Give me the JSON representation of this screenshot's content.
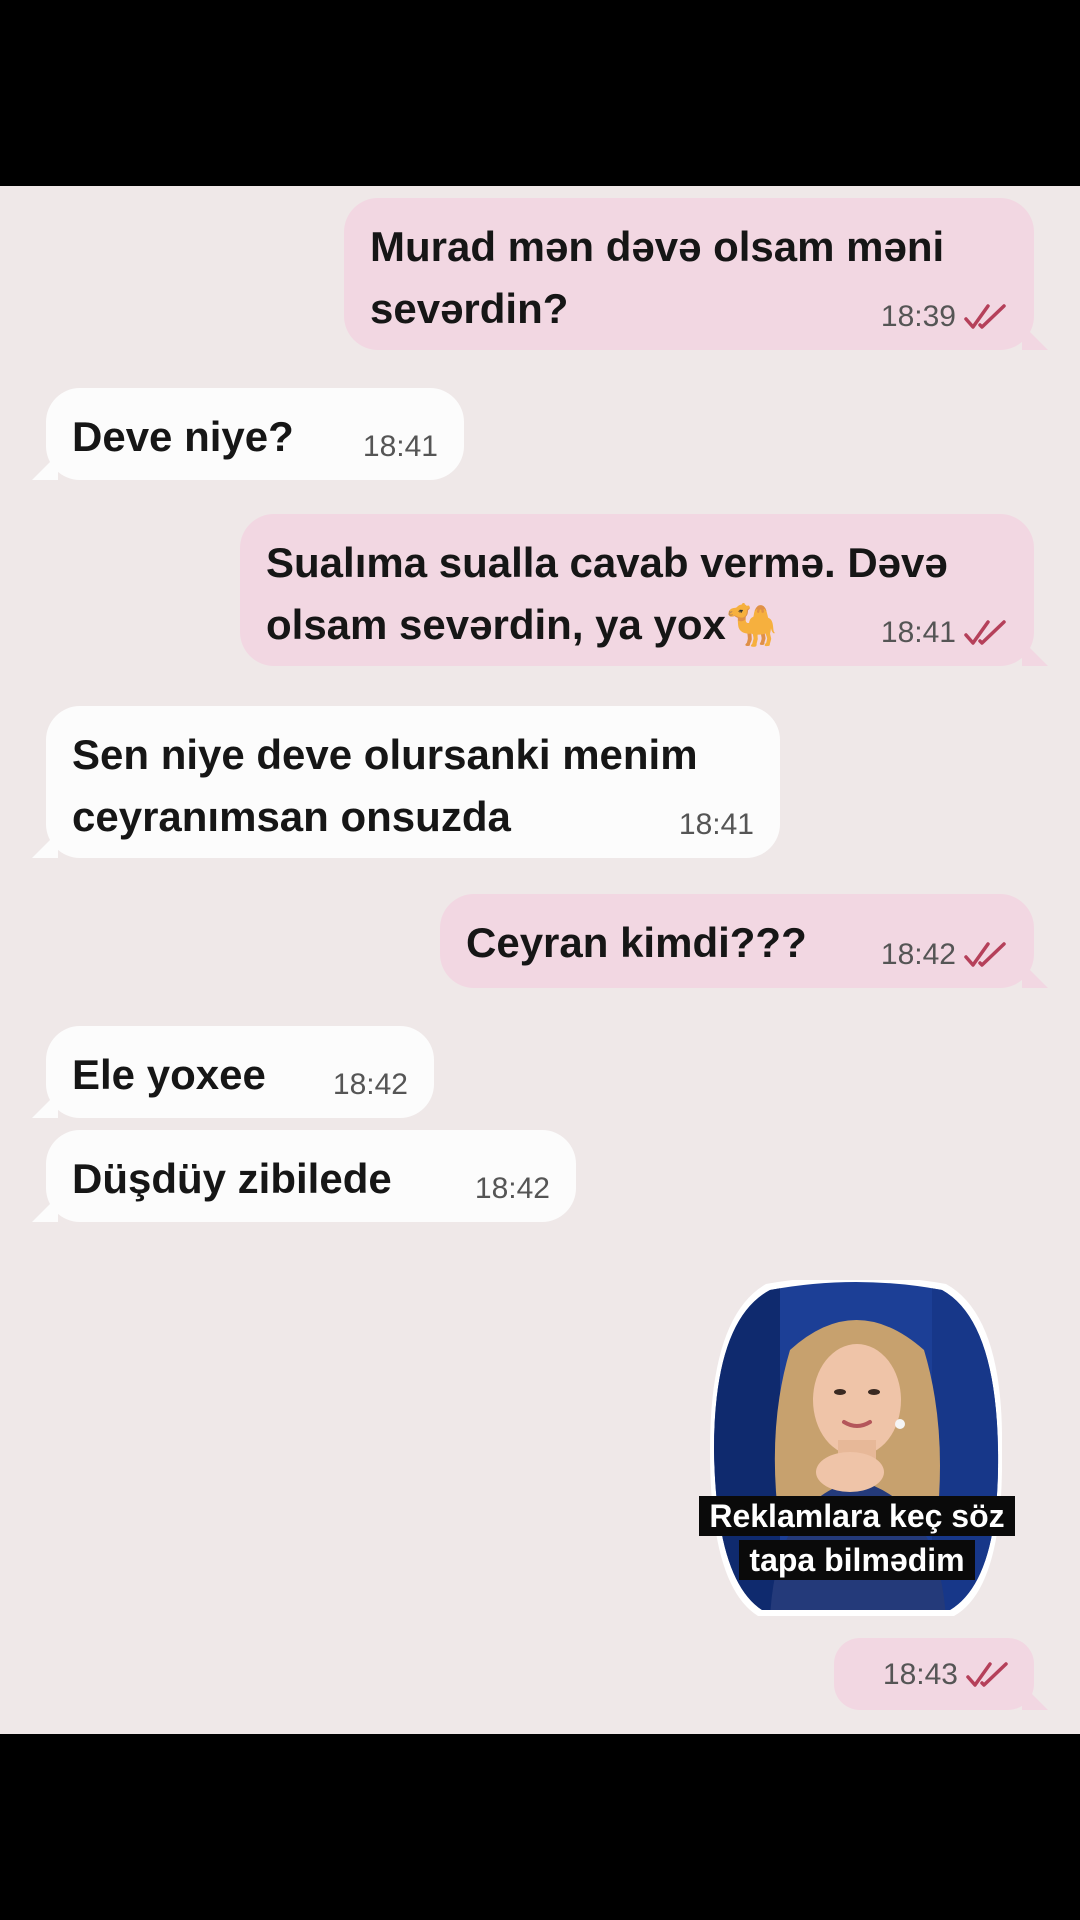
{
  "messages": [
    {
      "dir": "out",
      "text": "Murad mən dəvə olsam məni\nsevərdin?",
      "time": "18:39",
      "read": true
    },
    {
      "dir": "in",
      "text": "Deve niye?",
      "time": "18:41"
    },
    {
      "dir": "out",
      "text": "Sualıma sualla cavab vermə. Dəvə\nolsam sevərdin, ya yox🐪",
      "time": "18:41",
      "read": true
    },
    {
      "dir": "in",
      "text": "Sen niye deve olursanki menim\nceyranımsan onsuzda",
      "time": "18:41"
    },
    {
      "dir": "out",
      "text": "Ceyran kimdi???",
      "time": "18:42",
      "read": true
    },
    {
      "dir": "in",
      "text": "Ele yoxee",
      "time": "18:42"
    },
    {
      "dir": "in",
      "text": "Düşdüy zibilede",
      "time": "18:42"
    }
  ],
  "sticker": {
    "caption": "Reklamlara keç söz tapa bilmədim",
    "time": "18:43",
    "read": true
  },
  "colors": {
    "chat_bg": "#efe8e8",
    "outgoing_bubble": "#f2d7e2",
    "incoming_bubble": "#fcfcfc",
    "read_ticks": "#b5405a"
  }
}
